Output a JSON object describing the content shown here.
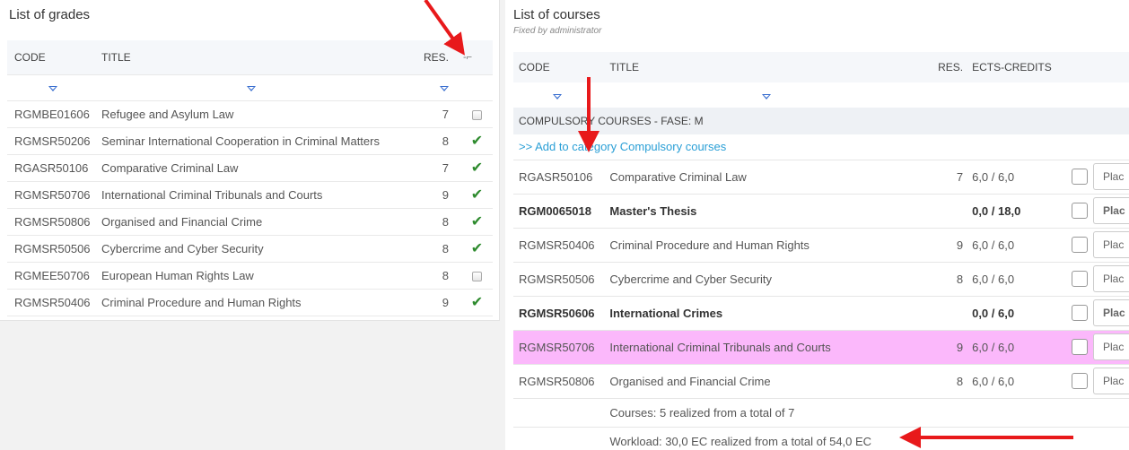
{
  "left_panel": {
    "title": "List of grades",
    "columns": {
      "code": "CODE",
      "title": "TITLE",
      "res": "RES."
    },
    "rows": [
      {
        "code": "RGMBE01606",
        "title": "Refugee and Asylum Law",
        "res": "7",
        "done": false
      },
      {
        "code": "RGMSR50206",
        "title": "Seminar International Cooperation in Criminal Matters",
        "res": "8",
        "done": true
      },
      {
        "code": "RGASR50106",
        "title": "Comparative Criminal Law",
        "res": "7",
        "done": true
      },
      {
        "code": "RGMSR50706",
        "title": "International Criminal Tribunals and Courts",
        "res": "9",
        "done": true
      },
      {
        "code": "RGMSR50806",
        "title": "Organised and Financial Crime",
        "res": "8",
        "done": true
      },
      {
        "code": "RGMSR50506",
        "title": "Cybercrime and Cyber Security",
        "res": "8",
        "done": true
      },
      {
        "code": "RGMEE50706",
        "title": "European Human Rights Law",
        "res": "8",
        "done": false
      },
      {
        "code": "RGMSR50406",
        "title": "Criminal Procedure and Human Rights",
        "res": "9",
        "done": true
      }
    ]
  },
  "right_panel": {
    "title": "List of courses",
    "subtitle": "Fixed by administrator",
    "columns": {
      "code": "CODE",
      "title": "TITLE",
      "res": "RES.",
      "ects": "ECTS-CREDITS"
    },
    "category": "COMPULSORY COURSES - FASE: M",
    "add_link": ">> Add to category Compulsory courses",
    "place_label": "Plac",
    "rows": [
      {
        "code": "RGASR50106",
        "title": "Comparative Criminal Law",
        "res": "7",
        "ects": "6,0 / 6,0",
        "bold": false,
        "highlight": false
      },
      {
        "code": "RGM0065018",
        "title": "Master's Thesis",
        "res": "",
        "ects": "0,0 / 18,0",
        "bold": true,
        "highlight": false
      },
      {
        "code": "RGMSR50406",
        "title": "Criminal Procedure and Human Rights",
        "res": "9",
        "ects": "6,0 / 6,0",
        "bold": false,
        "highlight": false
      },
      {
        "code": "RGMSR50506",
        "title": "Cybercrime and Cyber Security",
        "res": "8",
        "ects": "6,0 / 6,0",
        "bold": false,
        "highlight": false
      },
      {
        "code": "RGMSR50606",
        "title": "International Crimes",
        "res": "",
        "ects": "0,0 / 6,0",
        "bold": true,
        "highlight": false
      },
      {
        "code": "RGMSR50706",
        "title": "International Criminal Tribunals and Courts",
        "res": "9",
        "ects": "6,0 / 6,0",
        "bold": false,
        "highlight": true
      },
      {
        "code": "RGMSR50806",
        "title": "Organised and Financial Crime",
        "res": "8",
        "ects": "6,0 / 6,0",
        "bold": false,
        "highlight": false
      }
    ],
    "summary_courses": "Courses: 5 realized from a total of 7",
    "summary_workload": "Workload: 30,0 EC realized from a total of 54,0 EC"
  },
  "colors": {
    "highlight_row": "#fbb8fb",
    "annotation_arrow": "#e8191b",
    "check_green": "#2e8b2e",
    "link_blue": "#2a9fd6",
    "filter_blue": "#3a6fd0"
  }
}
